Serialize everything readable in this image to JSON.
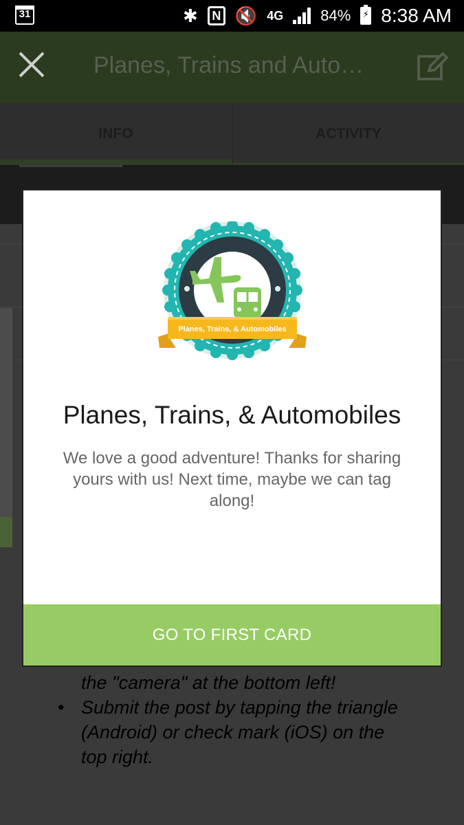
{
  "status_bar": {
    "calendar_day": "31",
    "icons": [
      "calendar-icon",
      "bluetooth-icon",
      "nfc-icon",
      "mute-icon",
      "4g-lte-icon",
      "signal-icon",
      "battery-charging-icon"
    ],
    "nfc_letter": "N",
    "network": "4G",
    "battery_percent": "84%",
    "time": "8:38 AM"
  },
  "toolbar": {
    "title": "Planes, Trains and Auto…",
    "close_icon": "close-icon",
    "edit_icon": "edit-icon"
  },
  "tabs": [
    {
      "label": "INFO",
      "active": true
    },
    {
      "label": "ACTIVITY",
      "active": false
    }
  ],
  "background_list": {
    "item1_partial": "the \"camera\" at the bottom left!",
    "item2_line1": "Submit the post by tapping the triangle",
    "item2_line2": "(Android) or check mark (iOS) on the",
    "item2_line3": "top right."
  },
  "dialog": {
    "badge_icon": "planes-trains-automobiles-badge",
    "badge_ribbon_text": "Planes, Trains, & Automobiles",
    "title": "Planes, Trains, & Automobiles",
    "message": "We love a good adventure! Thanks for sharing yours with us! Next time, maybe we can tag along!",
    "button_label": "GO TO FIRST CARD",
    "colors": {
      "button": "#97cc64",
      "badge_teal": "#23b5b0",
      "badge_dark": "#2d3b44",
      "badge_green": "#86c55a",
      "ribbon": "#f6b81c"
    }
  }
}
